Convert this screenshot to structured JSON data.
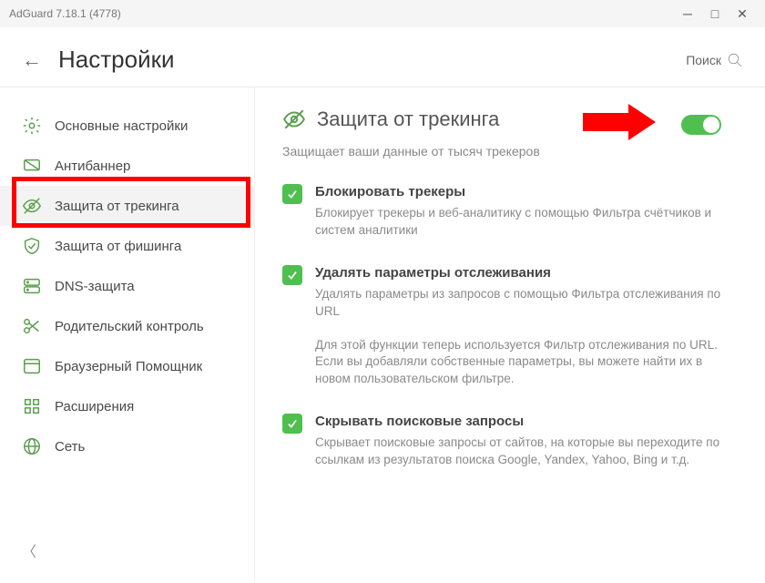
{
  "window": {
    "title": "AdGuard 7.18.1 (4778)"
  },
  "header": {
    "title": "Настройки",
    "search": "Поиск"
  },
  "sidebar": {
    "items": [
      {
        "label": "Основные настройки"
      },
      {
        "label": "Антибаннер"
      },
      {
        "label": "Защита от трекинга"
      },
      {
        "label": "Защита от фишинга"
      },
      {
        "label": "DNS-защита"
      },
      {
        "label": "Родительский контроль"
      },
      {
        "label": "Браузерный Помощник"
      },
      {
        "label": "Расширения"
      },
      {
        "label": "Сеть"
      }
    ]
  },
  "page": {
    "title": "Защита от трекинга",
    "subtitle": "Защищает ваши данные от тысяч трекеров",
    "toggle": true,
    "options": [
      {
        "title": "Блокировать трекеры",
        "desc": "Блокирует трекеры и веб-аналитику с помощью Фильтра счётчиков и систем аналитики"
      },
      {
        "title": "Удалять параметры отслеживания",
        "desc": "Удалять параметры из запросов с помощью Фильтра отслеживания по URL"
      },
      {
        "title": "Скрывать поисковые запросы",
        "desc": "Скрывает поисковые запросы от сайтов, на которые вы переходите по ссылкам из результатов поиска Google, Yandex, Yahoo, Bing и т.д."
      }
    ],
    "note": "Для этой функции теперь используется Фильтр отслеживания по URL. Если вы добавляли собственные параметры, вы можете найти их в новом пользовательском фильтре."
  },
  "colors": {
    "accent": "#4fbf4f",
    "highlight": "#ff0000"
  }
}
